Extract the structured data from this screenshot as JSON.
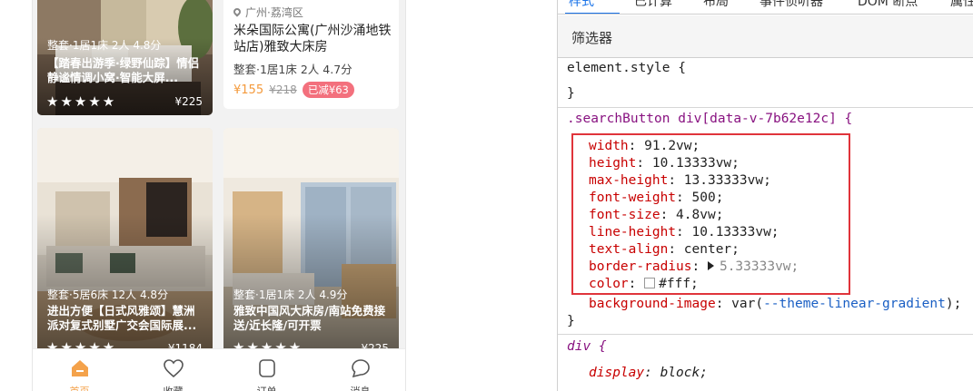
{
  "app": {
    "cards": [
      {
        "meta": "整套·1居1床 2人 4.8分",
        "title": "【踏春出游季·绿野仙踪】情侣静谧情调小窝·智能大屏...",
        "price": "¥225"
      },
      {
        "location": "广州·荔湾区",
        "title": "米朵国际公寓(广州沙涌地铁站店)雅致大床房",
        "meta": "整套·1居1床 2人 4.7分",
        "price_now": "¥155",
        "price_old": "¥218",
        "discount": "已减¥63"
      },
      {
        "meta": "整套·5居6床 12人 4.8分",
        "title": "进出方便【日式风雅颂】慧洲派对复式别墅广交会国际展...",
        "price": "¥1184"
      },
      {
        "meta": "整套·1居1床 2人 4.9分",
        "title": "雅致中国风大床房/南站免费接送/近长隆/可开票",
        "price": "¥225"
      }
    ],
    "stars": "★★★★★",
    "tabs": [
      {
        "label": "首页",
        "icon": "home-icon"
      },
      {
        "label": "收藏",
        "icon": "heart-icon"
      },
      {
        "label": "订单",
        "icon": "order-icon"
      },
      {
        "label": "消息",
        "icon": "message-icon"
      }
    ],
    "colors": {
      "accent": "#f4a24b",
      "discount": "#f3707d"
    }
  },
  "devtools": {
    "tabs": [
      "样式",
      "已计算",
      "布局",
      "事件侦听器",
      "DOM 断点",
      "属性"
    ],
    "active_tab": "样式",
    "filter_placeholder": "筛选器",
    "element_style": {
      "selector": "element.style {",
      "close": "}"
    },
    "rule": {
      "selector": ".searchButton div[data-v-7b62e12c] {",
      "props": [
        {
          "name": "width",
          "value": "91.2vw;"
        },
        {
          "name": "height",
          "value": "10.13333vw;"
        },
        {
          "name": "max-height",
          "value": "13.33333vw;"
        },
        {
          "name": "font-weight",
          "value": "500;"
        },
        {
          "name": "font-size",
          "value": "4.8vw;"
        },
        {
          "name": "line-height",
          "value": "10.13333vw;"
        },
        {
          "name": "text-align",
          "value": "center;"
        },
        {
          "name": "border-radius",
          "value": "5.33333vw;"
        },
        {
          "name": "color",
          "value": "#fff;"
        }
      ],
      "bg_name": "background-image",
      "bg_value_prefix": "var(",
      "bg_value_var": "--theme-linear-gradient",
      "bg_value_suffix": ");",
      "close": "}"
    },
    "ua_rule": {
      "selector": "div {",
      "prop_name": "display",
      "prop_value": "block;"
    },
    "colors": {
      "highlight_border": "#e0343b",
      "selector": "#881280",
      "property": "#c80000"
    }
  }
}
